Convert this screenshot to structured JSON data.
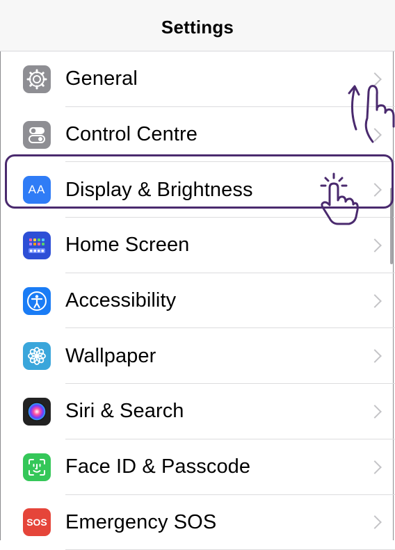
{
  "nav": {
    "title": "Settings"
  },
  "rows": [
    {
      "label": "General",
      "icon": "gear-icon",
      "color": "#8e8e93"
    },
    {
      "label": "Control Centre",
      "icon": "toggles-icon",
      "color": "#8e8e93"
    },
    {
      "label": "Display & Brightness",
      "icon": "text-size-icon",
      "color": "#2f7cf6",
      "icon_text": "AA"
    },
    {
      "label": "Home Screen",
      "icon": "app-grid-icon",
      "color": "#2d4fd6"
    },
    {
      "label": "Accessibility",
      "icon": "accessibility-icon",
      "color": "#1a7cf5"
    },
    {
      "label": "Wallpaper",
      "icon": "flower-icon",
      "color": "#3aa6db"
    },
    {
      "label": "Siri & Search",
      "icon": "siri-icon",
      "color": "#222222"
    },
    {
      "label": "Face ID & Passcode",
      "icon": "face-id-icon",
      "color": "#35c759"
    },
    {
      "label": "Emergency SOS",
      "icon": "sos-icon",
      "color": "#e5453a",
      "icon_text": "SOS"
    }
  ],
  "annotations": {
    "highlight_color": "#4a2a6e",
    "gestures": [
      "swipe-up-hand-icon",
      "tap-hand-icon"
    ]
  }
}
